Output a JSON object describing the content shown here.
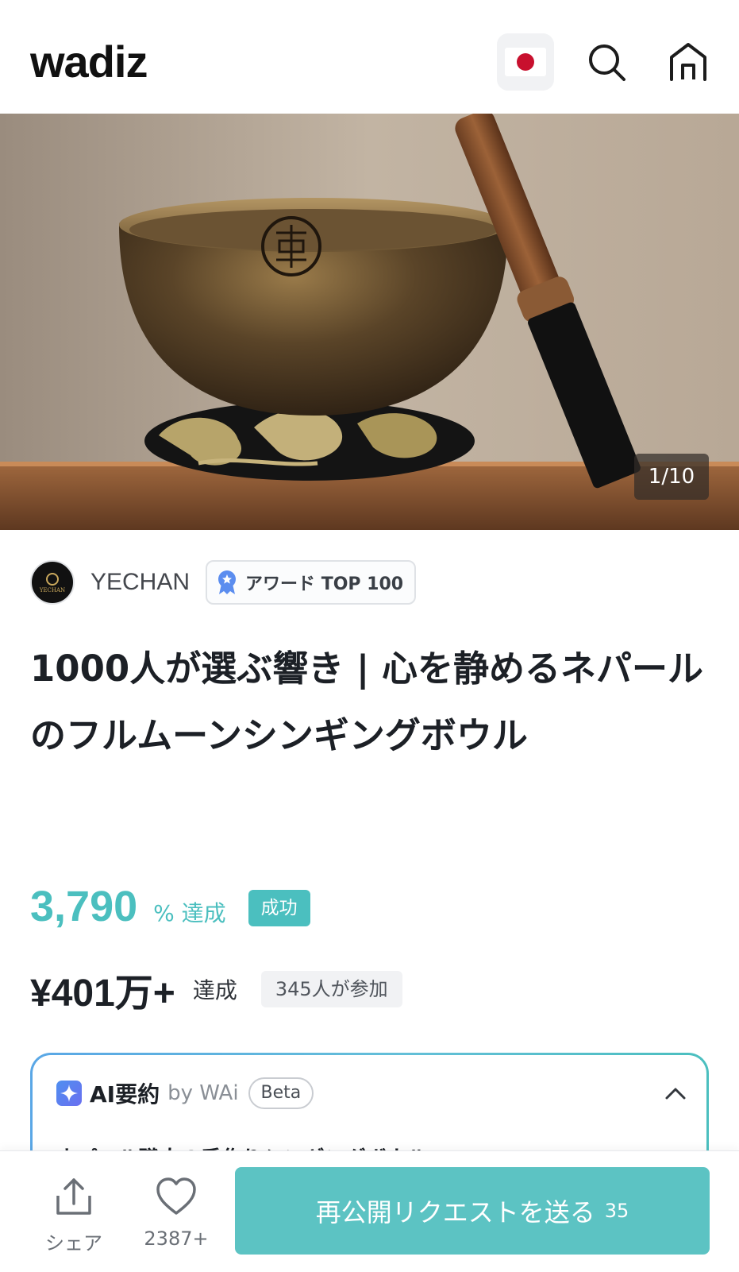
{
  "header": {
    "logo_text": "wadiz",
    "language_flag": "japan-flag-icon",
    "icons": [
      "search-icon",
      "home-icon"
    ]
  },
  "hero": {
    "image_subject": "singing-bowl-photo",
    "counter": "1/10"
  },
  "maker": {
    "name": "YECHAN",
    "avatar_text": "YECHAN",
    "award_label": "アワード TOP 100"
  },
  "project": {
    "title": "1000人が選ぶ響き | 心を静めるネパールのフルムーンシンギングボウル",
    "achievement_rate": "3,790",
    "achievement_suffix": "% 達成",
    "status_badge": "成功",
    "amount": "¥401万+",
    "amount_suffix": "達成",
    "participants": "345人が参加"
  },
  "ai_summary": {
    "title": "AI要約",
    "by": "by WAi",
    "beta": "Beta",
    "preview": "ネパール職人の手作りシンギングボウル"
  },
  "bottom_bar": {
    "share_label": "シェア",
    "like_count": "2387+",
    "request_label": "再公開リクエストを送る",
    "request_count": "35"
  },
  "colors": {
    "accent": "#4bbfbf",
    "request_button": "#5cc3c3",
    "flag_red": "#c8102e",
    "ai_gradient_start": "#5aa7e6"
  }
}
